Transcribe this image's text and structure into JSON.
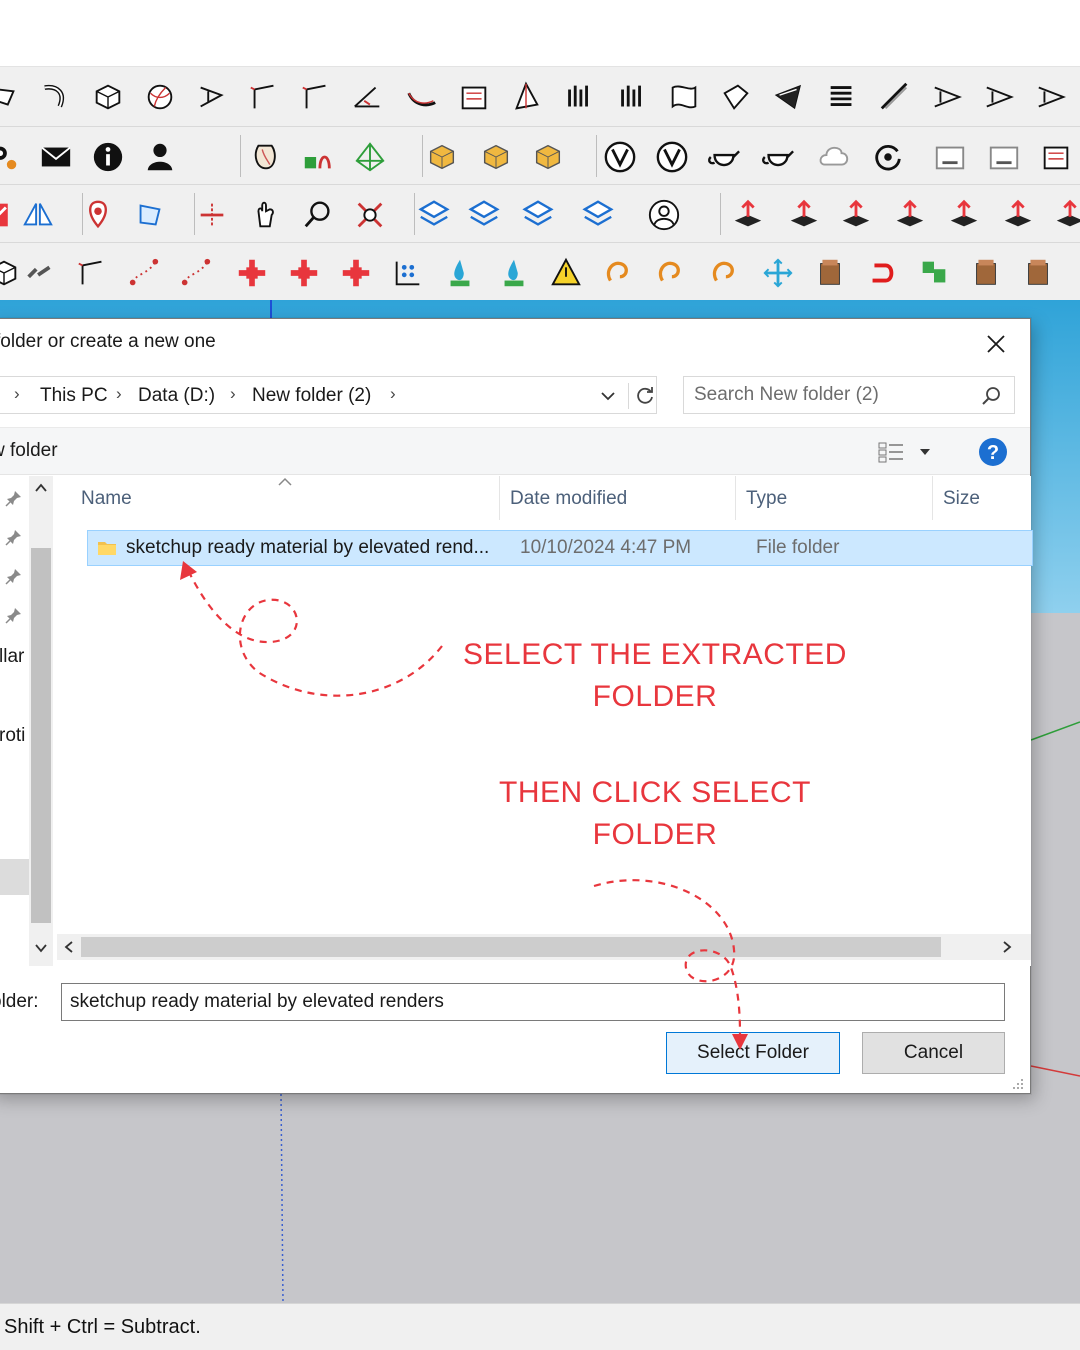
{
  "status_bar": {
    "text": "Shift + Ctrl = Subtract."
  },
  "toolbar": {
    "row1": [
      "follow-me-icon",
      "pipe-icon",
      "box-icon",
      "sphere-icon",
      "flow-icon",
      "corner-icon",
      "corner-icon",
      "angle-icon",
      "curve-icon",
      "frame-icon",
      "shape-icon",
      "columns-icon",
      "columns-icon",
      "drape-icon",
      "surface-icon",
      "plane-icon",
      "stack-icon",
      "slope-icon",
      "stair-icon",
      "stair-icon",
      "stair-icon"
    ],
    "row2": [
      "settings-icon",
      "mail-icon",
      "info-icon",
      "user-icon",
      "sandbox-icon",
      "tools-icon",
      "mesh-icon",
      "cube-icon",
      "cube-icon",
      "cube-icon",
      "vray-icon",
      "vray-icon",
      "teapot-icon",
      "teapot-icon",
      "cloud-icon",
      "refresh-icon",
      "render-icon",
      "render-icon",
      "frame-icon"
    ],
    "row3": [
      "arrow-icon",
      "mirror-icon",
      "pin-icon",
      "select-icon",
      "split-icon",
      "hand-icon",
      "search-icon",
      "expand-icon",
      "layer-icon",
      "layer-icon",
      "layer-icon",
      "layer-icon",
      "person-icon",
      "push-icon",
      "push-icon",
      "push-icon",
      "push-icon",
      "push-icon",
      "push-icon",
      "push-icon"
    ],
    "row4": [
      "box-icon",
      "chain-icon",
      "corner-icon",
      "point-icon",
      "point-icon",
      "cross-icon",
      "cross-icon",
      "cross-icon",
      "grid-icon",
      "drop-icon",
      "drop-icon",
      "warning-icon",
      "loop-icon",
      "loop-icon",
      "loop-icon",
      "move-icon",
      "bucket-icon",
      "undo-icon",
      "puzzle-icon",
      "bucket-icon",
      "bucket-icon"
    ]
  },
  "dialog": {
    "title": "folder or create a new one",
    "breadcrumb": [
      "This PC",
      "Data (D:)",
      "New folder (2)"
    ],
    "search_placeholder": "Search New folder (2)",
    "new_folder_label": "w folder",
    "nav_items": [
      "llar",
      "roti"
    ],
    "columns": [
      "Name",
      "Date modified",
      "Type",
      "Size"
    ],
    "rows": [
      {
        "name": "sketchup ready material by elevated rend...",
        "date": "10/10/2024 4:47 PM",
        "type": "File folder",
        "size": ""
      }
    ],
    "folder_label": "older:",
    "folder_value": "sketchup ready material by elevated renders",
    "select_button": "Select Folder",
    "cancel_button": "Cancel"
  },
  "annotations": {
    "step1": [
      "SELECT THE EXTRACTED",
      "FOLDER"
    ],
    "step2": [
      "THEN CLICK SELECT",
      "FOLDER"
    ],
    "color": "#e8363d"
  },
  "colors": {
    "sky_top": "#2fa3d8",
    "ground": "#c6c6ca",
    "selection": "#cce8ff",
    "accent": "#0078d7"
  }
}
